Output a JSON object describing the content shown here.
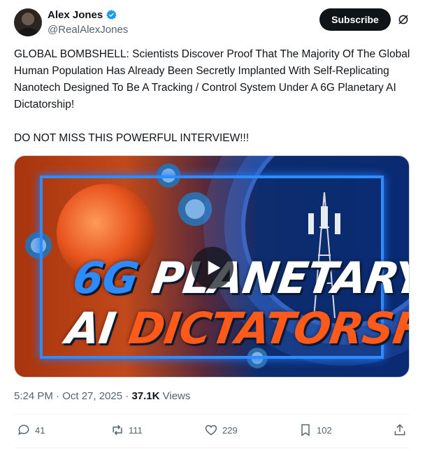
{
  "author": {
    "name": "Alex Jones",
    "handle": "@RealAlexJones"
  },
  "header": {
    "subscribe_label": "Subscribe"
  },
  "post": {
    "text": "GLOBAL BOMBSHELL: Scientists Discover Proof That The Majority Of The Global Human Population Has Already Been Secretly Implanted With Self-Replicating Nanotech Designed To Be A Tracking / Control System Under A 6G Planetary AI Dictatorship!\n\nDO NOT MISS THIS POWERFUL INTERVIEW!!!",
    "media": {
      "line1_accent": "6G",
      "line1_rest": "PLANETARY",
      "line2_rest": "AI",
      "line2_accent": "DICTATORSHIP!"
    },
    "timestamp": "5:24 PM · Oct 27, 2025",
    "separator": " · ",
    "views_count": "37.1K",
    "views_label": "Views"
  },
  "actions": {
    "replies": "41",
    "reposts": "111",
    "likes": "229",
    "bookmarks": "102"
  },
  "icons": {
    "verified": "verified-badge-icon",
    "grok": "grok-icon",
    "reply": "reply-icon",
    "repost": "repost-icon",
    "like": "heart-icon",
    "bookmark": "bookmark-icon",
    "share": "share-icon",
    "play": "play-icon"
  },
  "colors": {
    "verified_blue": "#1d9bf0",
    "text": "#0f1419",
    "secondary": "#536471"
  }
}
